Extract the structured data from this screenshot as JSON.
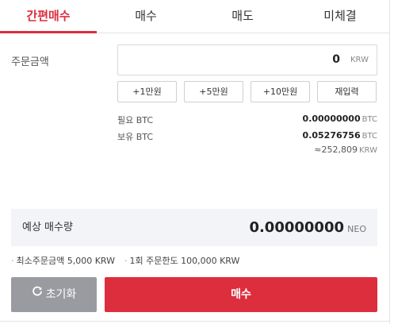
{
  "tabs": [
    {
      "label": "간편매수"
    },
    {
      "label": "매수"
    },
    {
      "label": "매도"
    },
    {
      "label": "미체결"
    }
  ],
  "order_amount": {
    "label": "주문금액",
    "value": "0",
    "unit": "KRW"
  },
  "quick_buttons": [
    "+1만원",
    "+5만원",
    "+10만원",
    "재입력"
  ],
  "info": {
    "required": {
      "label": "필요 BTC",
      "value": "0.00000000",
      "unit": "BTC"
    },
    "holding": {
      "label": "보유 BTC",
      "value": "0.05276756",
      "unit": "BTC"
    },
    "holding_krw": {
      "value": "≈252,809",
      "unit": "KRW"
    }
  },
  "estimate": {
    "label": "예상 매수량",
    "value": "0.00000000",
    "unit": "NEO"
  },
  "notes": {
    "min_order": "최소주문금액 5,000 KRW",
    "max_order": "1회 주문한도 100,000 KRW",
    "bullet": "·"
  },
  "buttons": {
    "reset": "초기화",
    "buy": "매수"
  },
  "colors": {
    "accent": "#dd2e3e",
    "reset_bg": "#9a9ba0",
    "panel_bg": "#f3f4f7"
  }
}
